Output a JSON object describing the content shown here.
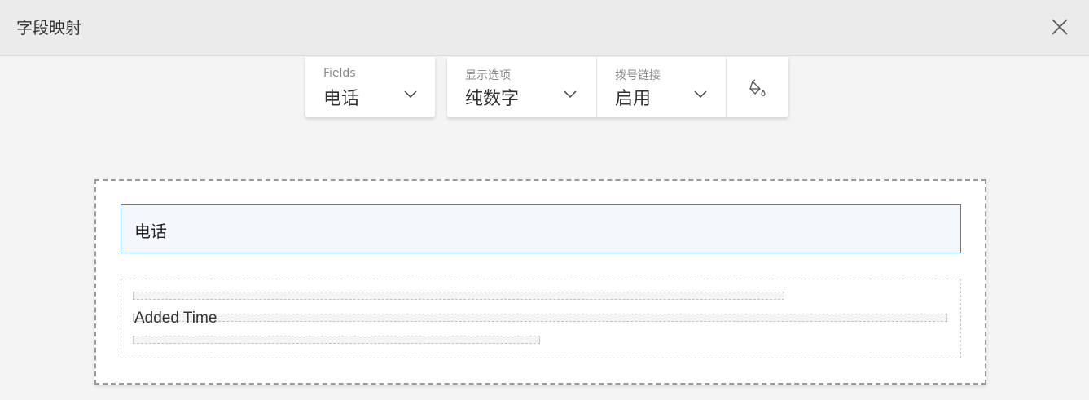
{
  "header": {
    "title": "字段映射",
    "close_icon": "close-icon"
  },
  "toolbar": {
    "fields": {
      "label": "Fields",
      "value": "电话"
    },
    "display_option": {
      "label": "显示选项",
      "value": "纯数字"
    },
    "dial_link": {
      "label": "拨号链接",
      "value": "启用"
    },
    "style_icon": "paint-bucket-icon"
  },
  "canvas": {
    "field_value": "电话",
    "sub_label": "Added Time"
  },
  "colors": {
    "accent": "#3d82d6",
    "header_bg": "#ebebeb",
    "page_bg": "#f4f4f4"
  }
}
